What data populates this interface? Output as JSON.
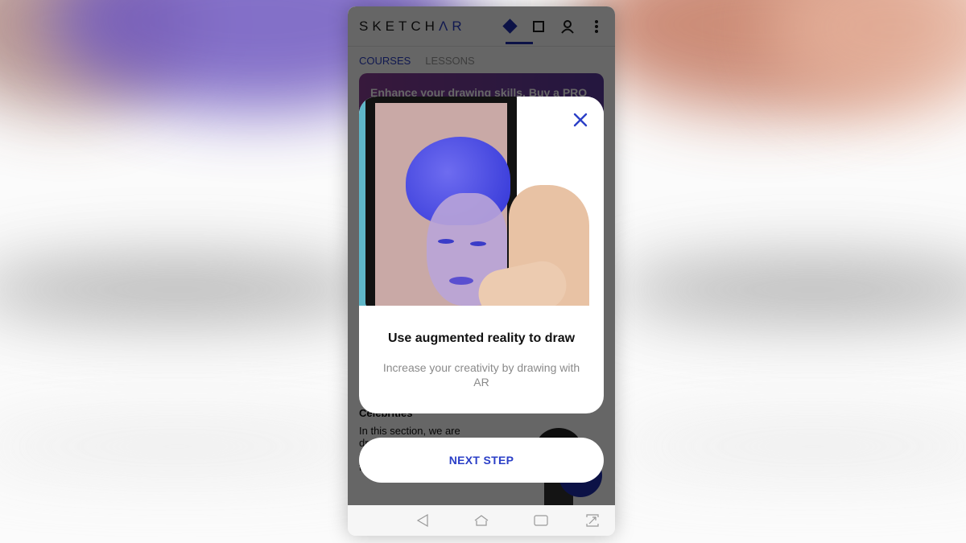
{
  "app": {
    "logo_main": "SKETCH",
    "logo_accent": "ΛR",
    "brand_color": "#1f2fb0",
    "top_icons": [
      "diamond-icon",
      "square-icon",
      "profile-icon",
      "more-vert-icon"
    ]
  },
  "tabs": [
    {
      "label": "COURSES",
      "active": true
    },
    {
      "label": "LESSONS",
      "active": false
    }
  ],
  "promo": {
    "text": "Enhance your drawing skills. Buy a PRO"
  },
  "section": {
    "title": "Celebrities",
    "description": "In this section, we are drawing... popular singers and other prominent cultural figures. ..."
  },
  "modal": {
    "title": "Use augmented reality to draw",
    "description": "Increase your creativity by drawing with AR",
    "close_icon": "close-icon",
    "hero_image": "hand holding phone showing blue AR portrait sketch"
  },
  "next_button": {
    "label": "NEXT STEP"
  },
  "navbar": {
    "items": [
      "back-icon",
      "home-icon",
      "recents-icon",
      "fullscreen-icon"
    ]
  }
}
